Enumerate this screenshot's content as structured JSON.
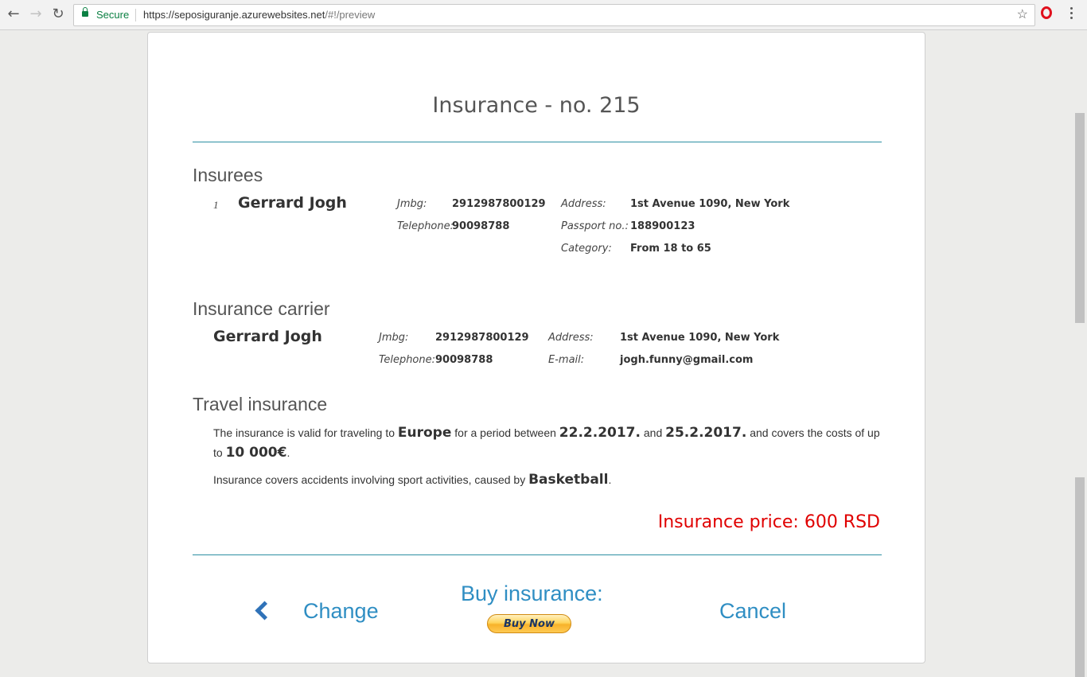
{
  "browser": {
    "secure_label": "Secure",
    "url_base": "https://seposiguranje.azurewebsites.net",
    "url_path": "/#!/preview"
  },
  "page": {
    "title": "Insurance - no. 215"
  },
  "insurees": {
    "heading": "Insurees",
    "items": [
      {
        "index": "1",
        "name": "Gerrard Jogh",
        "jmbg_label": "Jmbg:",
        "jmbg": "2912987800129",
        "telephone_label": "Telephone:",
        "telephone": "90098788",
        "address_label": "Address:",
        "address": "1st Avenue 1090, New York",
        "passport_label": "Passport no.:",
        "passport": "188900123",
        "category_label": "Category:",
        "category": "From 18 to 65"
      }
    ]
  },
  "carrier": {
    "heading": "Insurance carrier",
    "name": "Gerrard Jogh",
    "jmbg_label": "Jmbg:",
    "jmbg": "2912987800129",
    "telephone_label": "Telephone:",
    "telephone": "90098788",
    "address_label": "Address:",
    "address": "1st Avenue 1090, New York",
    "email_label": "E-mail:",
    "email": "jogh.funny@gmail.com"
  },
  "travel": {
    "heading": "Travel insurance",
    "p1_a": "The insurance is valid for traveling to",
    "destination": "Europe",
    "p1_b": "for a period between",
    "start_date": "22.2.2017.",
    "p1_c": "and",
    "end_date": "25.2.2017.",
    "p1_d": "and covers the costs of up",
    "p1_e": "to",
    "coverage": "10 000€",
    "p1_f": ".",
    "p2_a": "Insurance covers accidents involving sport activities, caused by",
    "sport": "Basketball",
    "p2_b": "."
  },
  "price": {
    "label": "Insurance price: 600 RSD"
  },
  "actions": {
    "change_label": "Change",
    "buy_label": "Buy insurance:",
    "buy_now_label": "Buy Now",
    "cancel_label": "Cancel"
  },
  "colors": {
    "accent": "#2f8ec3",
    "rule": "#2d8fa3",
    "price": "#e00000"
  }
}
